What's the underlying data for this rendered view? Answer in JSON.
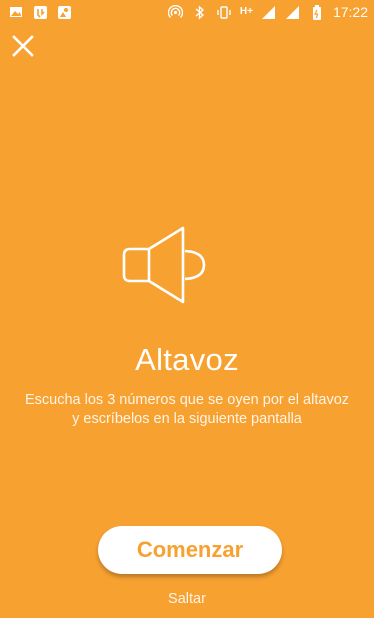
{
  "status_bar": {
    "left_icons": [
      "image-icon",
      "app-notification-icon",
      "map-notification-icon"
    ],
    "right_icons": [
      "hotspot-icon",
      "bluetooth-icon",
      "vibrate-icon",
      "signal-icon",
      "signal-icon",
      "battery-icon"
    ],
    "network": "H+",
    "time": "17:22"
  },
  "close": {
    "icon": "close-icon"
  },
  "hero": {
    "icon": "speaker-icon",
    "title": "Altavoz",
    "description": "Escucha los 3 números que se oyen por el altavoz y escríbelos en la siguiente pantalla"
  },
  "actions": {
    "start_label": "Comenzar",
    "skip_label": "Saltar"
  },
  "colors": {
    "background": "#F7A131",
    "button_background": "#FFFFFF",
    "button_text": "#F7A131",
    "text": "#FFFFFF"
  }
}
